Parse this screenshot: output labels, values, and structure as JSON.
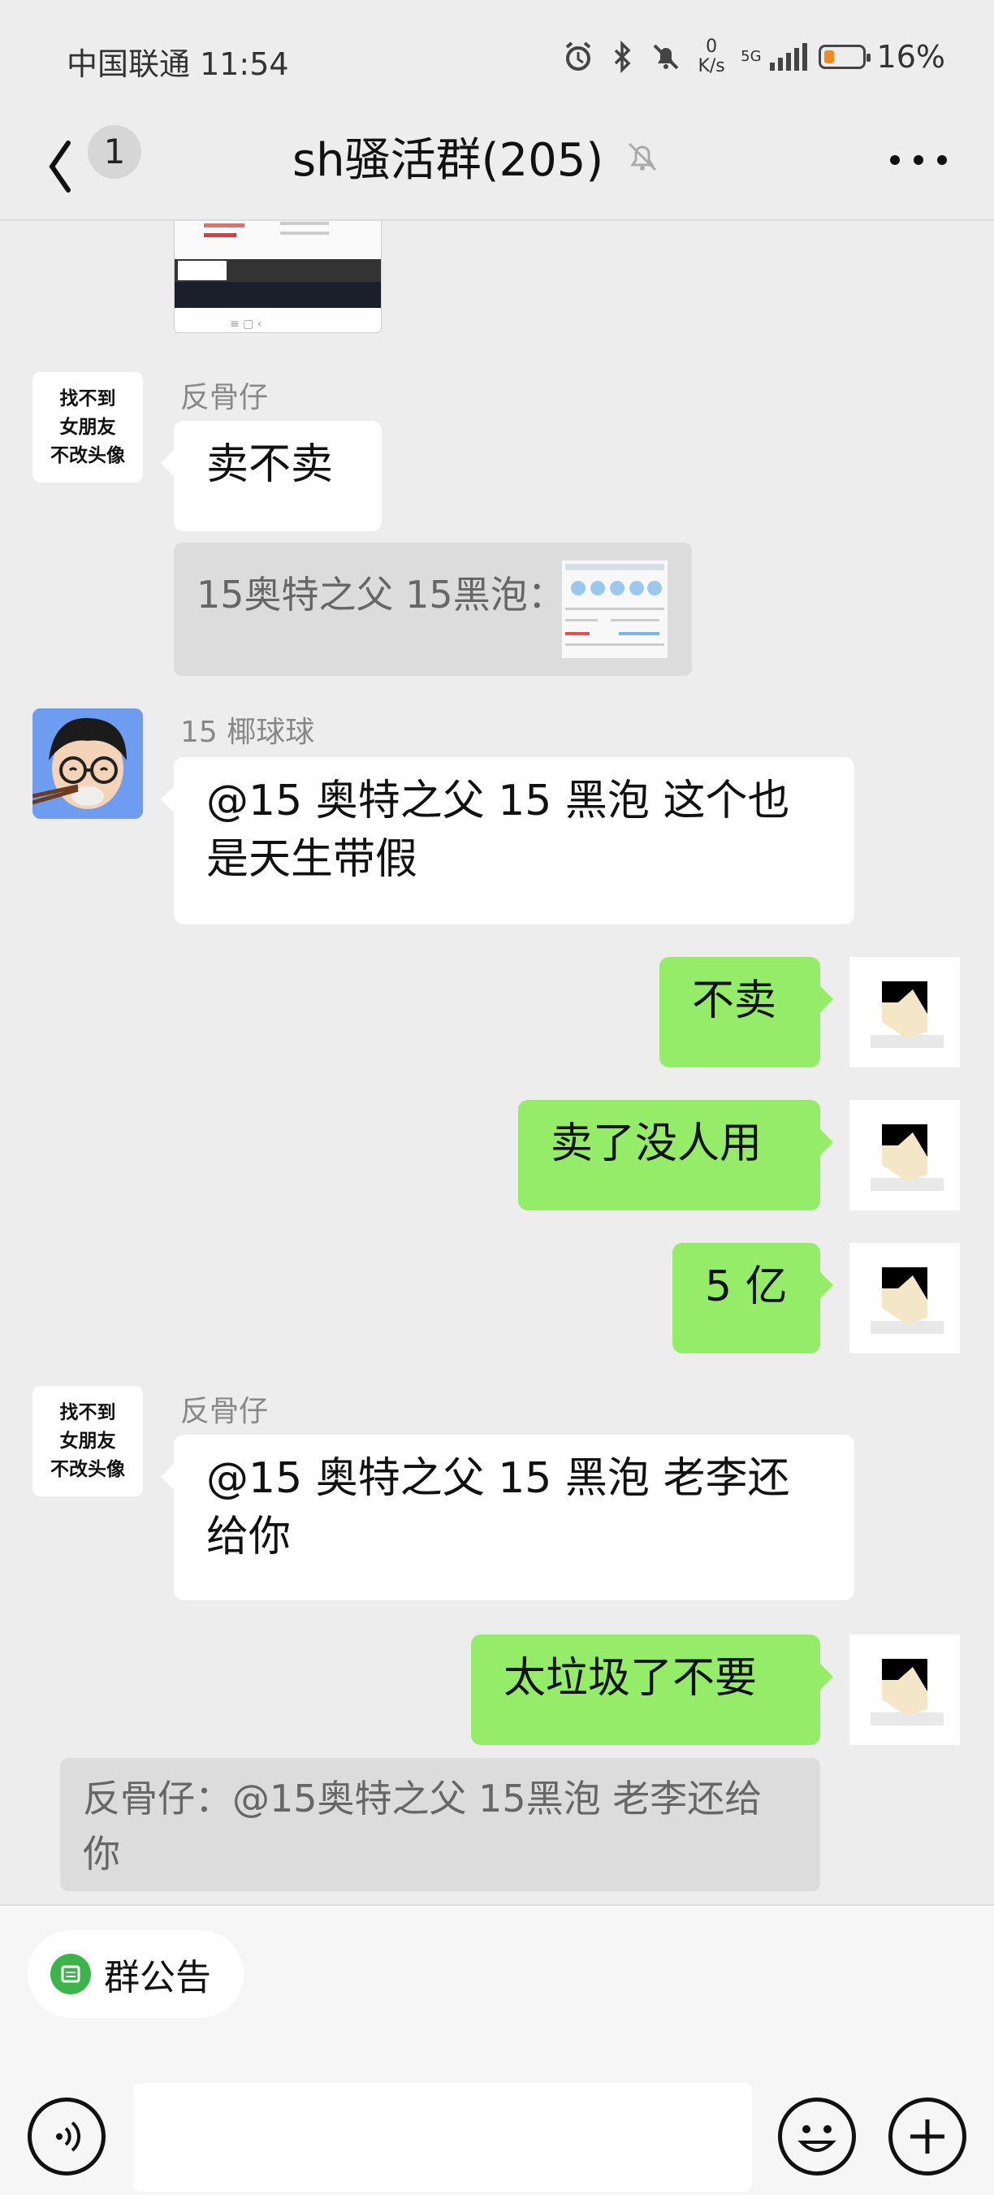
{
  "status_bar": {
    "carrier_time": "中国联通 11:54",
    "net_speed_value": "0",
    "net_speed_unit": "K/s",
    "network": "5G",
    "battery": "16%",
    "icons": [
      "alarm-icon",
      "bluetooth-icon",
      "mute-icon",
      "signal-icon",
      "battery-icon"
    ],
    "battery_color": "#f08a24"
  },
  "header": {
    "unread_count": "1",
    "title": "sh骚活群(205)",
    "icons": [
      "back-icon",
      "mute-bell-icon",
      "more-icon"
    ]
  },
  "messages": [
    {
      "type": "image",
      "side": "left"
    },
    {
      "type": "text",
      "side": "left",
      "nickname": "反骨仔",
      "avatar_text": "找不到\n女朋友\n不改头像",
      "text": "卖不卖"
    },
    {
      "type": "quote",
      "side": "left",
      "text": "15奥特之父 15黑泡："
    },
    {
      "type": "text",
      "side": "left",
      "nickname": "15 椰球球",
      "text": "@15 奥特之父 15 黑泡  这个也是天生带假"
    },
    {
      "type": "text",
      "side": "right",
      "text": "不卖"
    },
    {
      "type": "text",
      "side": "right",
      "text": "卖了没人用"
    },
    {
      "type": "text",
      "side": "right",
      "text": "5 亿"
    },
    {
      "type": "text",
      "side": "left",
      "nickname": "反骨仔",
      "avatar_text": "找不到\n女朋友\n不改头像",
      "text": "@15 奥特之父 15 黑泡  老李还给你"
    },
    {
      "type": "text",
      "side": "right",
      "text": "太垃圾了不要"
    },
    {
      "type": "quote",
      "side": "left",
      "text": "反骨仔：@15奥特之父 15黑泡 老李还给你"
    }
  ],
  "bottom_bar": {
    "notice_label": "群公告",
    "icons": [
      "voice-icon",
      "emoji-icon",
      "plus-icon"
    ],
    "input_value": ""
  },
  "colors": {
    "background": "#ededed",
    "bubble_self": "#95ec69",
    "bubble_other": "#ffffff",
    "notice_icon": "#3bb54a"
  }
}
